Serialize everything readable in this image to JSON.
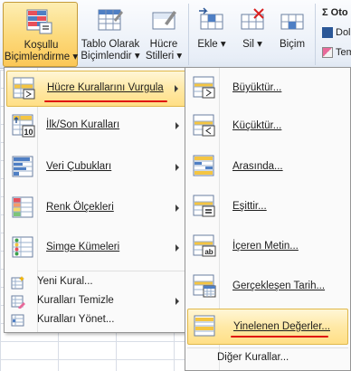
{
  "ribbon": {
    "conditional_formatting": {
      "line1": "Koşullu",
      "line2": "Biçimlendirme ▾"
    },
    "format_as_table": {
      "line1": "Tablo Olarak",
      "line2": "Biçimlendir ▾"
    },
    "cell_styles": {
      "line1": "Hücre",
      "line2": "Stilleri ▾"
    },
    "insert": {
      "label": "Ekle ▾"
    },
    "delete": {
      "label": "Sil ▾"
    },
    "format": {
      "label": "Biçim"
    },
    "autosum": {
      "label": "Σ Oto"
    },
    "fill": {
      "label": "Dol"
    },
    "clear": {
      "label": "Tem"
    }
  },
  "menu_left": {
    "items": [
      {
        "label": "Hücre Kurallarını Vurgula",
        "icon": "highlight-cells-rules-icon",
        "submenu": true,
        "highlighted": true
      },
      {
        "label": "İlk/Son Kuralları",
        "icon": "top-bottom-rules-icon",
        "submenu": true
      },
      {
        "label": "Veri Çubukları",
        "icon": "data-bars-icon",
        "submenu": true
      },
      {
        "label": "Renk Ölçekleri",
        "icon": "color-scales-icon",
        "submenu": true
      },
      {
        "label": "Simge Kümeleri",
        "icon": "icon-sets-icon",
        "submenu": true
      }
    ],
    "small_items": [
      {
        "label": "Yeni Kural...",
        "icon": "new-rule-icon",
        "submenu": false
      },
      {
        "label": "Kuralları Temizle",
        "icon": "clear-rules-icon",
        "submenu": true
      },
      {
        "label": "Kuralları Yönet...",
        "icon": "manage-rules-icon",
        "submenu": false
      }
    ],
    "icon_number": "10"
  },
  "menu_right": {
    "items": [
      {
        "label": "Büyüktür...",
        "icon": "greater-than-icon"
      },
      {
        "label": "Küçüktür...",
        "icon": "less-than-icon"
      },
      {
        "label": "Arasında...",
        "icon": "between-icon"
      },
      {
        "label": "Eşittir...",
        "icon": "equal-to-icon"
      },
      {
        "label": "İçeren Metin...",
        "icon": "text-contains-icon"
      },
      {
        "label": "Gerçekleşen Tarih...",
        "icon": "date-occurring-icon"
      },
      {
        "label": "Yinelenen Değerler...",
        "icon": "duplicate-values-icon",
        "highlighted": true
      }
    ],
    "more_rules": "Diğer Kurallar...",
    "icon_text_ab": "ab"
  },
  "colors": {
    "highlight": "#ffe9a6",
    "annotation_red": "#e01010",
    "accent_blue": "#2b5797"
  }
}
